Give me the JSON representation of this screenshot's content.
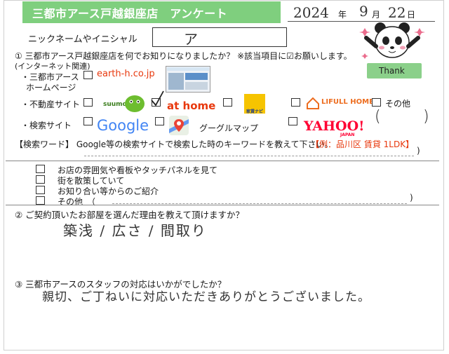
{
  "header": {
    "title": "三都市アース戸越銀座店　アンケート",
    "date": {
      "year": "2024",
      "year_unit": "年",
      "month": "9",
      "month_unit": "月",
      "day": "22",
      "day_unit": "日"
    }
  },
  "nickname": {
    "label": "ニックネームやイニシャル",
    "value": "ア"
  },
  "q1": {
    "text": "① 三都市アース戸越銀座店を何でお知りになりましたか？ ※該当項目に☑お願いします。",
    "internet_label": "(インターネット関連)",
    "homepage_label_1": "・三都市アース",
    "homepage_label_2": "ホームページ",
    "homepage_url": "earth-h.co.jp",
    "realestate_label": "・不動産サイト",
    "realestate_sites": [
      "suumo",
      "at home",
      "家賃ナビ",
      "LIFULL HOME'S",
      "その他"
    ],
    "search_label": "・検索サイト",
    "search_sites": [
      "Google",
      "グーグルマップ",
      "YAHOO!",
      "JAPAN"
    ],
    "keyword_label": "【検索ワード】 Google等の検索サイトで検索した時のキーワードを教えて下さい。",
    "keyword_example": "【例：品川区 賃貸 1LDK】",
    "other_options": [
      "お店の雰囲気や看板やタッチパネルを見て",
      "街を散策していて",
      "お知り合い等からのご紹介",
      "その他　（"
    ]
  },
  "q2": {
    "text": "② ご契約頂いたお部屋を選んだ理由を教えて頂けますか？",
    "answer": "築浅 / 広さ / 間取り"
  },
  "q3": {
    "text": "③ 三都市アースのスタッフの対応はいかがでしたか？",
    "answer": "親切、ご丁ねいに対応いただきありがとうございました。"
  },
  "mascot": {
    "thank_label": "Thank"
  },
  "colors": {
    "band_green": "#7fcf7e",
    "google_blue": "#4285f4",
    "athome_red": "#e8380d",
    "yahoo_red": "#ff0033",
    "homes_orange": "#ed6d1f"
  }
}
